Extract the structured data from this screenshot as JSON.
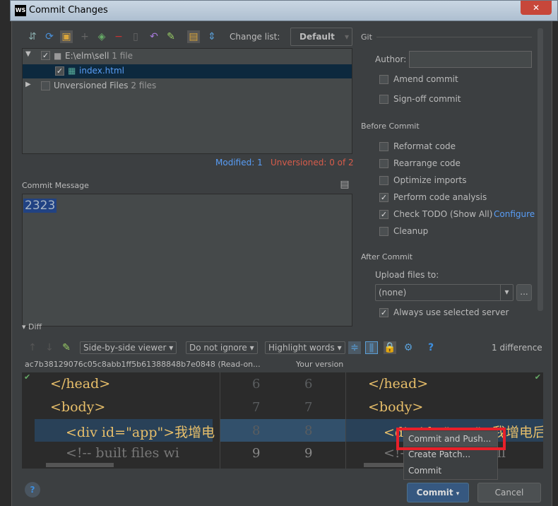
{
  "window": {
    "title": "Commit Changes",
    "logo": "WS"
  },
  "toolbar": {
    "change_list_label": "Change list:",
    "change_list_value": "Default",
    "icons": [
      "show-diff-icon",
      "refresh-icon",
      "group-icon",
      "add-icon",
      "move-icon",
      "remove-icon",
      "compare-icon",
      "rollback-icon",
      "edit-icon",
      "preview-icon",
      "expand-icon"
    ]
  },
  "tree": {
    "items": [
      {
        "label": "E:\\elm\\sell",
        "count": "1 file",
        "checked": true
      },
      {
        "label": "index.html",
        "checked": true
      },
      {
        "label": "Unversioned Files",
        "count": "2 files",
        "checked": false
      }
    ]
  },
  "status": {
    "modified": "Modified: 1",
    "unversioned": "Unversioned: 0 of 2"
  },
  "commit_message": {
    "label": "Commit Message",
    "value": "2323"
  },
  "git": {
    "title": "Git",
    "author_label": "Author:",
    "author_value": "",
    "amend": "Amend commit",
    "signoff": "Sign-off commit"
  },
  "before_commit": {
    "title": "Before Commit",
    "options": [
      {
        "label": "Reformat code",
        "checked": false
      },
      {
        "label": "Rearrange code",
        "checked": false
      },
      {
        "label": "Optimize imports",
        "checked": false
      },
      {
        "label": "Perform code analysis",
        "checked": true
      },
      {
        "label": "Check TODO (Show All)",
        "checked": true
      },
      {
        "label": "Cleanup",
        "checked": false
      }
    ],
    "configure": "Configure"
  },
  "after_commit": {
    "title": "After Commit",
    "upload_label": "Upload files to:",
    "upload_value": "(none)",
    "more": "...",
    "always_use": "Always use selected server",
    "always_checked": true
  },
  "diff": {
    "title": "Diff",
    "viewer": "Side-by-side viewer",
    "ignore": "Do not ignore",
    "highlight": "Highlight words",
    "count": "1 difference",
    "left_title": "ac7b38129076c05c8abb1ff5b61388848b7e0848 (Read-on...",
    "right_title": "Your version",
    "lines": [
      {
        "n": "6",
        "left": "</head>",
        "right": "</head>"
      },
      {
        "n": "7",
        "left": "<body>",
        "right": "<body>"
      },
      {
        "n": "8",
        "left": "<div id=\"app\">我增电",
        "right": "<div id=\"app\">我增电后"
      },
      {
        "n": "9",
        "left": "<!-- built files wi",
        "right": "<!-- built files will"
      }
    ]
  },
  "menu": {
    "items": [
      "Commit and Push...",
      "Create Patch...",
      "Commit"
    ]
  },
  "buttons": {
    "commit": "Commit",
    "cancel": "Cancel",
    "help": "?"
  },
  "colors": {
    "accent": "#589df6",
    "error": "#d75c4b",
    "selection": "#0d293e",
    "highlight_box": "#e8202a"
  }
}
